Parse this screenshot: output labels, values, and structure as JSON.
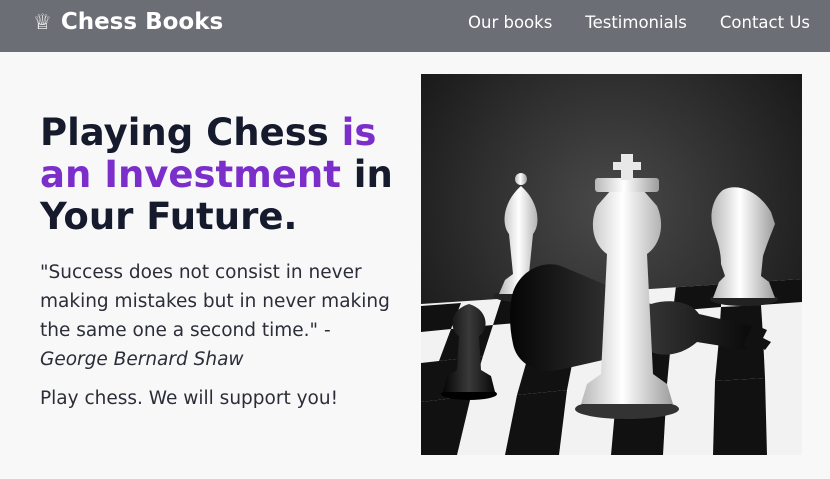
{
  "brand": {
    "icon": "crown-icon",
    "glyph": "♕",
    "name": "Chess Books"
  },
  "nav": {
    "items": [
      {
        "label": "Our books"
      },
      {
        "label": "Testimonials"
      },
      {
        "label": "Contact Us"
      }
    ]
  },
  "hero": {
    "title_part1": "Playing Chess ",
    "title_accent": "is an Investment",
    "title_part2": " in Your Future.",
    "quote_text": "\"Success does not consist in never making mistakes but in never making the same one a second time.\" - ",
    "quote_author": "George Bernard Shaw",
    "tagline": "Play chess. We will support you!"
  },
  "colors": {
    "navbar": "#6c6e75",
    "accent": "#7b2ec9",
    "text": "#161a2d",
    "background": "#f8f8f9"
  }
}
